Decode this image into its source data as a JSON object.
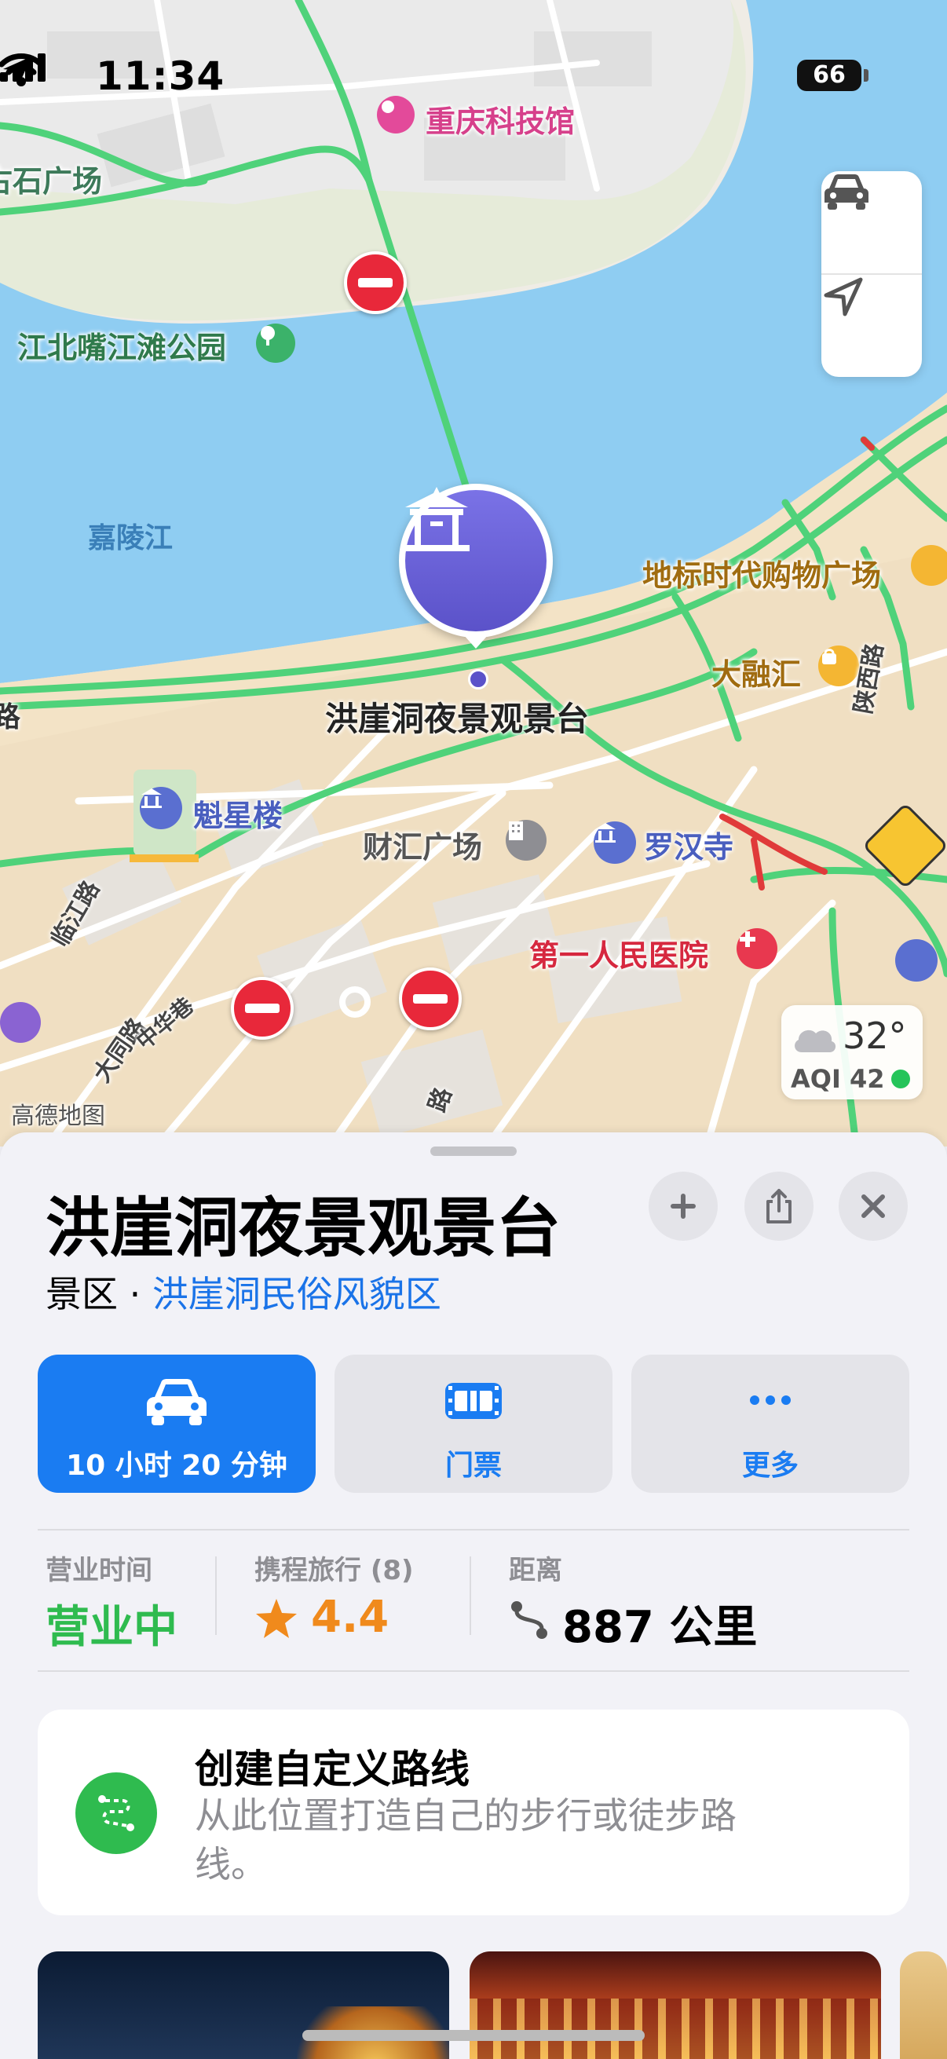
{
  "status_bar": {
    "time": "11:34",
    "battery": "66"
  },
  "map": {
    "labels": {
      "chongqing_science_museum": "重庆科技馆",
      "stone_square": "古石广场",
      "jiangbeizui_park": "江北嘴江滩公园",
      "jialing_river": "嘉陵江",
      "landmark_mall": "地标时代购物广场",
      "darongui": "大融汇",
      "road_left": "路",
      "shaanxi_road": "陕西路",
      "kuixinglou": "魁星楼",
      "caihui_plaza": "财汇广场",
      "luohan_temple": "罗汉寺",
      "first_hospital": "第一人民医院",
      "linjiang_road": "临江路",
      "datong_road": "大同路",
      "zhonghua_lane": "中华巷",
      "gaode_map": "高德地图",
      "road_bottom": "路",
      "selected_pin": "洪崖洞夜景观景台"
    },
    "weather": {
      "temp": "32°",
      "aqi": "AQI 42"
    }
  },
  "place": {
    "title": "洪崖洞夜景观景台",
    "category": "景区",
    "separator": " · ",
    "area_link": "洪崖洞民俗风貌区"
  },
  "actions": [
    {
      "label": "10 小时 20 分钟",
      "icon": "car-icon",
      "primary": true
    },
    {
      "label": "门票",
      "icon": "ticket-icon",
      "primary": false
    },
    {
      "label": "更多",
      "icon": "more-icon",
      "primary": false
    }
  ],
  "info": {
    "hours_label": "营业时间",
    "hours_value": "营业中",
    "rating_label": "携程旅行 (8)",
    "rating_value": "4.4",
    "distance_label": "距离",
    "distance_value": "887 公里"
  },
  "custom_route": {
    "title": "创建自定义路线",
    "desc": "从此位置打造自己的步行或徒步路线。"
  },
  "colors": {
    "accent": "#1a73e8",
    "open_green": "#2fbb4f",
    "rating_orange": "#f08a1c",
    "pin_purple": "#6b63d8"
  }
}
